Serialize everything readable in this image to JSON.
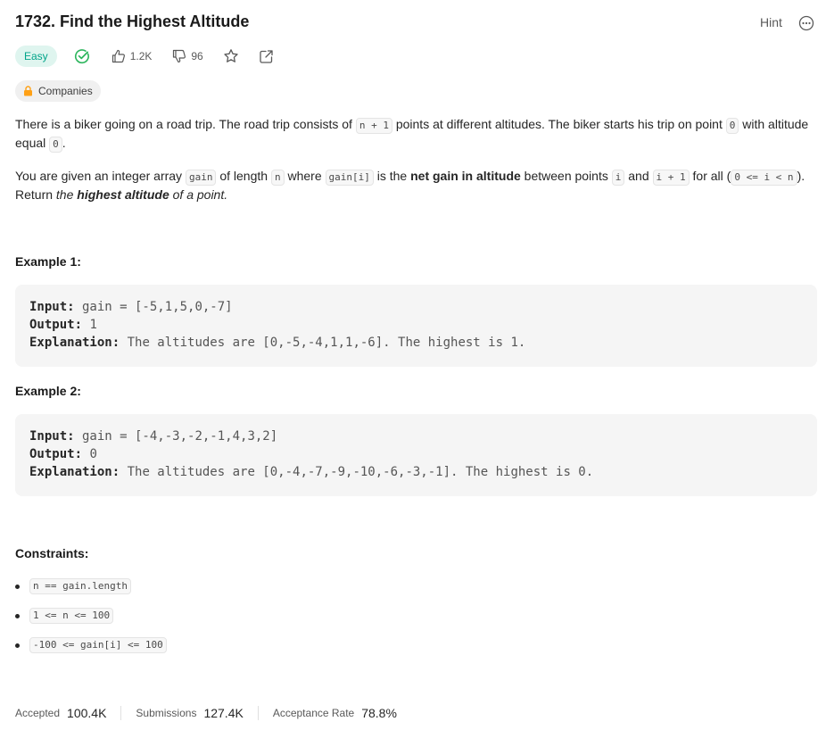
{
  "problem": {
    "title": "1732. Find the Highest Altitude",
    "hint_label": "Hint",
    "difficulty": "Easy",
    "likes": "1.2K",
    "dislikes": "96",
    "companies_label": "Companies"
  },
  "description": {
    "p1": {
      "t1": "There is a biker going on a road trip. The road trip consists of ",
      "c1": "n + 1",
      "t2": " points at different altitudes. The biker starts his trip on point ",
      "c2": "0",
      "t3": " with altitude equal ",
      "c3": "0",
      "t4": "."
    },
    "p2": {
      "t1": "You are given an integer array ",
      "c1": "gain",
      "t2": " of length ",
      "c2": "n",
      "t3": " where ",
      "c3": "gain[i]",
      "t4": " is the ",
      "b1": "net gain in altitude",
      "t5": " between points ",
      "c4": "i",
      "t6": " and ",
      "c5": "i + 1",
      "t7": " for all (",
      "c6": "0 <= i < n",
      "t8": ")."
    },
    "p3": {
      "t1": "Return ",
      "i1": "the ",
      "b1": "highest altitude",
      "i2": " of a point."
    }
  },
  "examples": [
    {
      "heading": "Example 1:",
      "input_label": "Input:",
      "input": " gain = [-5,1,5,0,-7]",
      "output_label": "Output:",
      "output": " 1",
      "explanation_label": "Explanation:",
      "explanation": " The altitudes are [0,-5,-4,1,1,-6]. The highest is 1."
    },
    {
      "heading": "Example 2:",
      "input_label": "Input:",
      "input": " gain = [-4,-3,-2,-1,4,3,2]",
      "output_label": "Output:",
      "output": " 0",
      "explanation_label": "Explanation:",
      "explanation": " The altitudes are [0,-4,-7,-9,-10,-6,-3,-1]. The highest is 0."
    }
  ],
  "constraints": {
    "heading": "Constraints:",
    "items": [
      "n == gain.length",
      "1 <= n <= 100",
      "-100 <= gain[i] <= 100"
    ]
  },
  "stats": {
    "accepted_label": "Accepted",
    "accepted": "100.4K",
    "submissions_label": "Submissions",
    "submissions": "127.4K",
    "rate_label": "Acceptance Rate",
    "rate": "78.8%"
  },
  "colors": {
    "easy": "#00a489",
    "easy_bg": "#dff5ef",
    "solved_check": "#2db55d",
    "lock": "#ffa116",
    "code_bg": "#f5f5f5"
  },
  "icons": {
    "solved": "check-circle-icon",
    "like": "thumbs-up-icon",
    "dislike": "thumbs-down-icon",
    "favorite": "star-icon",
    "share": "share-icon",
    "more": "more-icon",
    "companies": "lock-icon"
  }
}
